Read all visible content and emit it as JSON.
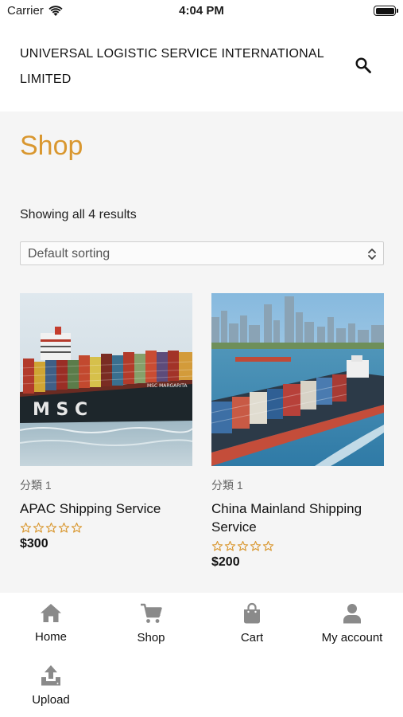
{
  "status_bar": {
    "carrier": "Carrier",
    "time": "4:04 PM"
  },
  "header": {
    "site_title": "UNIVERSAL LOGISTIC SERVICE INTERNATIONAL LIMITED"
  },
  "shop": {
    "title": "Shop",
    "result_count": "Showing all 4 results",
    "sort_selected": "Default sorting"
  },
  "products": [
    {
      "category": "分類 1",
      "name": "APAC Shipping Service",
      "rating": 0,
      "price": "$300"
    },
    {
      "category": "分類 1",
      "name": "China Mainland Shipping Service",
      "rating": 0,
      "price": "$200"
    }
  ],
  "tabs": [
    {
      "label": "Home",
      "icon": "home-icon"
    },
    {
      "label": "Shop",
      "icon": "cart-icon"
    },
    {
      "label": "Cart",
      "icon": "shopping-bag-icon"
    },
    {
      "label": "My account",
      "icon": "user-icon"
    },
    {
      "label": "Upload",
      "icon": "upload-icon"
    }
  ],
  "colors": {
    "accent": "#d9972f",
    "icon_gray": "#8a8a8a",
    "page_bg": "#f5f5f5"
  }
}
